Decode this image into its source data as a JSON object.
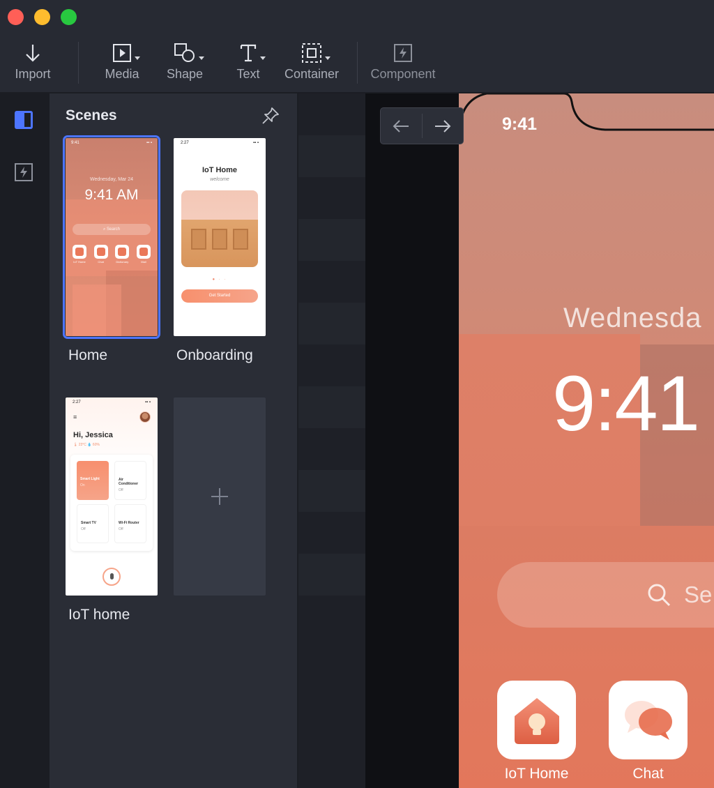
{
  "toolbar": {
    "import": "Import",
    "media": "Media",
    "shape": "Shape",
    "text": "Text",
    "container": "Container",
    "component": "Component"
  },
  "panel": {
    "title": "Scenes",
    "scenes": [
      {
        "name": "Home"
      },
      {
        "name": "Onboarding"
      },
      {
        "name": "IoT home"
      }
    ]
  },
  "thumb_home": {
    "status_time": "9:41",
    "date": "Wednesday, Mar 24",
    "time": "9:41 AM",
    "search": "Search",
    "apps": [
      "IoT Home",
      "Chat",
      "Dictionary",
      "Mail"
    ]
  },
  "thumb_onboarding": {
    "status_time": "2:27",
    "title": "IoT Home",
    "subtitle": "welcome",
    "button": "Get Started"
  },
  "thumb_iot": {
    "status_time": "2:27",
    "greeting": "Hi, Jessica",
    "meta": "🌡 23°C    💧 60%",
    "tiles": [
      {
        "name": "Smart Light",
        "state": "On"
      },
      {
        "name": "Air Conditioner",
        "state": "Off"
      },
      {
        "name": "Smart TV",
        "state": "Off"
      },
      {
        "name": "Wi-Fi Router",
        "state": "Off"
      }
    ]
  },
  "preview": {
    "status_time": "9:41",
    "date": "Wednesda",
    "clock": "9:41",
    "search": "Se",
    "apps": [
      "IoT Home",
      "Chat"
    ]
  },
  "colors": {
    "accent": "#4d75ff",
    "panel_bg": "#2a2d36",
    "toolbar_bg": "#272a33",
    "brand_coral": "#ea7859"
  }
}
